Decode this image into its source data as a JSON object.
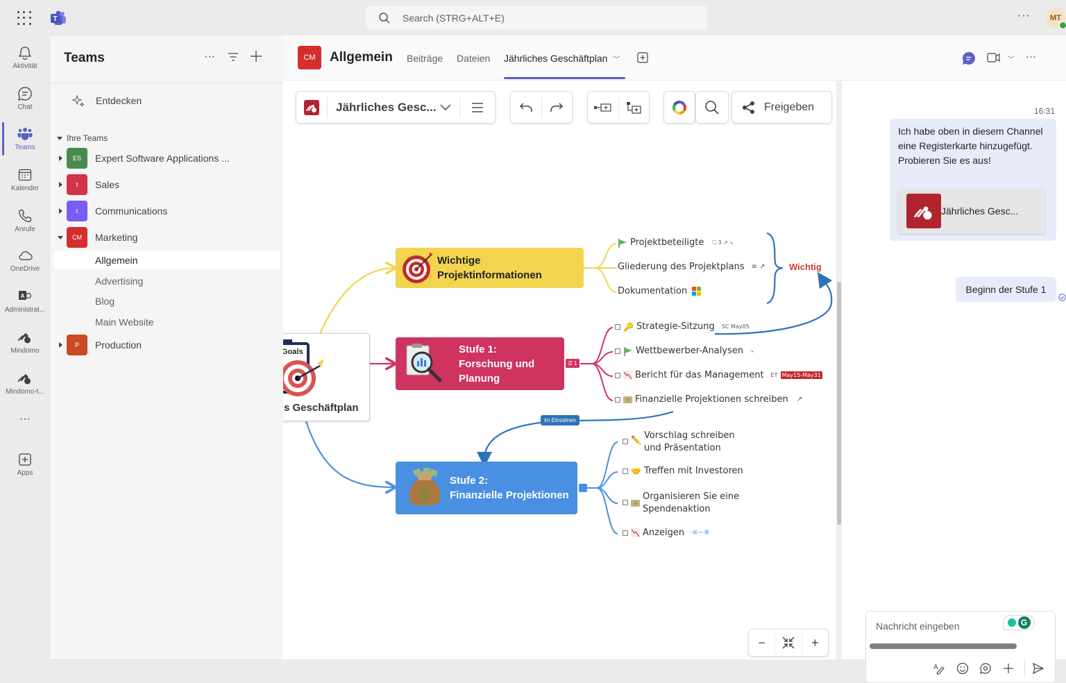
{
  "topbar": {
    "search_placeholder": "Search (STRG+ALT+E)",
    "more_label": "···",
    "user_initials": "MT",
    "accent": "#5b5fc7"
  },
  "rail": {
    "items": [
      {
        "label": "Aktivität",
        "icon": "bell-icon"
      },
      {
        "label": "Chat",
        "icon": "chat-icon"
      },
      {
        "label": "Teams",
        "icon": "teams-icon",
        "active": true
      },
      {
        "label": "Kalender",
        "icon": "calendar-icon"
      },
      {
        "label": "Anrufe",
        "icon": "phone-icon"
      },
      {
        "label": "OneDrive",
        "icon": "cloud-icon"
      },
      {
        "label": "Administrat...",
        "icon": "admin-icon"
      },
      {
        "label": "Mindomo",
        "icon": "mindomo-icon"
      },
      {
        "label": "Mindomo-t...",
        "icon": "mindomo-icon"
      },
      {
        "label": "···",
        "icon": "more-icon"
      },
      {
        "label": "Apps",
        "icon": "apps-icon"
      }
    ]
  },
  "teams_panel": {
    "title": "Teams",
    "more": "···",
    "discover": "Entdecken",
    "section": "Ihre Teams",
    "teams": [
      {
        "initials": "ES",
        "name": "Expert Software Applications ...",
        "color": "#4a8a4f",
        "expanded": false
      },
      {
        "initials": "t",
        "name": "Sales",
        "color": "#d1344b",
        "expanded": false
      },
      {
        "initials": "t",
        "name": "Communications",
        "color": "#7b5cf5",
        "expanded": false
      },
      {
        "initials": "CM",
        "name": "Marketing",
        "color": "#d42e2e",
        "expanded": true
      },
      {
        "initials": "P",
        "name": "Production",
        "color": "#c94a24",
        "expanded": false
      }
    ],
    "channels": [
      "Allgemein",
      "Advertising",
      "Blog",
      "Main Website"
    ],
    "selected_channel": "Allgemein"
  },
  "channel_header": {
    "avatar": "CM",
    "name": "Allgemein",
    "tabs": [
      "Beiträge",
      "Dateien",
      "Jährliches Geschäftplan"
    ],
    "active_tab": "Jährliches Geschäftplan",
    "more": "···"
  },
  "toolbar": {
    "map_title": "Jährliches Gesc...",
    "share_label": "Freigeben"
  },
  "mindmap": {
    "root": {
      "label": "s Geschäftplan",
      "image_label": "Goals"
    },
    "topics": [
      {
        "label_1": "Wichtige",
        "label_2": "Projektinformationen",
        "color": "#f2d44e",
        "children": [
          {
            "label": "Projektbeteiligte",
            "icon": "flag-icon",
            "meta": "🗨3 ↗ ⤷"
          },
          {
            "label": "Gliederung des Projektplans",
            "meta": "≡ ↗"
          },
          {
            "label": "Dokumentation",
            "icon": "microsoft-icon"
          }
        ],
        "boundary_label": "Wichtig"
      },
      {
        "label_1": "Stufe 1:",
        "label_2": "Forschung und",
        "label_3": "Planung",
        "color": "#cf3360",
        "task_count": "1",
        "children": [
          {
            "label": "Strategie-Sitzung",
            "icon": "key-icon",
            "meta": "SC  May05"
          },
          {
            "label": "Wettbewerber-Analysen",
            "icon": "flag-icon",
            "meta": "⤷"
          },
          {
            "label": "Bericht für das Management",
            "icon": "chart-down-icon",
            "meta": "ET",
            "badge": "May15-May31"
          },
          {
            "label": "Finanzielle Projektionen schreiben",
            "icon": "money-icon",
            "meta": "↗"
          }
        ]
      },
      {
        "label_1": "Stufe 2:",
        "label_2": "Finanzielle Projektionen",
        "color": "#4a90e2",
        "children": [
          {
            "label_1": "Vorschlag schreiben",
            "label_2": "und Präsentation",
            "icon": "pencil-icon"
          },
          {
            "label": "Treffen mit Investoren",
            "icon": "handshake-icon"
          },
          {
            "label_1": "Organisieren Sie eine",
            "label_2": "Spendenaktion",
            "icon": "money-icon"
          },
          {
            "label": "Anzeigen",
            "icon": "chart-down-icon",
            "meta": "·≡−⑥"
          }
        ]
      }
    ],
    "relationship_label": "im Einzelnen"
  },
  "zoom_controls": {
    "minus": "−",
    "plus": "+"
  },
  "chat": {
    "time": "16:31",
    "message1": "Ich habe oben in diesem Channel eine Registerkarte hinzugefügt. Probieren Sie es aus!",
    "card_title": "Jährliches Gesc...",
    "message2": "Beginn der Stufe 1",
    "composer_placeholder": "Nachricht eingeben"
  }
}
